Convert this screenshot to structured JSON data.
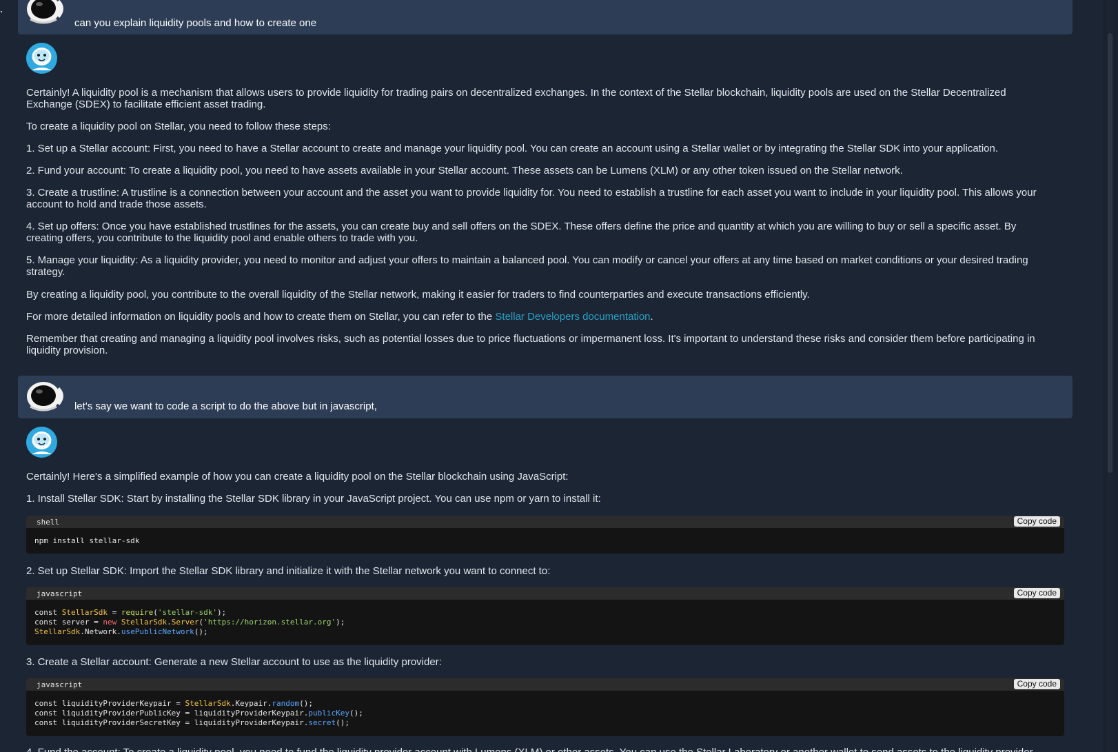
{
  "conversation": {
    "messages": [
      {
        "role": "user",
        "text": "can you explain liquidity pools and how to create one"
      },
      {
        "role": "assistant",
        "paragraphs": [
          "Certainly! A liquidity pool is a mechanism that allows users to provide liquidity for trading pairs on decentralized exchanges. In the context of the Stellar blockchain, liquidity pools are used on the Stellar Decentralized Exchange (SDEX) to facilitate efficient asset trading.",
          "To create a liquidity pool on Stellar, you need to follow these steps:",
          "1. Set up a Stellar account: First, you need to have a Stellar account to create and manage your liquidity pool. You can create an account using a Stellar wallet or by integrating the Stellar SDK into your application.",
          "2. Fund your account: To create a liquidity pool, you need to have assets available in your Stellar account. These assets can be Lumens (XLM) or any other token issued on the Stellar network.",
          "3. Create a trustline: A trustline is a connection between your account and the asset you want to provide liquidity for. You need to establish a trustline for each asset you want to include in your liquidity pool. This allows your account to hold and trade those assets.",
          "4. Set up offers: Once you have established trustlines for the assets, you can create buy and sell offers on the SDEX. These offers define the price and quantity at which you are willing to buy or sell a specific asset. By creating offers, you contribute to the liquidity pool and enable others to trade with you.",
          "5. Manage your liquidity: As a liquidity provider, you need to monitor and adjust your offers to maintain a balanced pool. You can modify or cancel your offers at any time based on market conditions or your desired trading strategy.",
          "By creating a liquidity pool, you contribute to the overall liquidity of the Stellar network, making it easier for traders to find counterparties and execute transactions efficiently.",
          "Remember that creating and managing a liquidity pool involves risks, such as potential losses due to price fluctuations or impermanent loss. It's important to understand these risks and consider them before participating in liquidity provision."
        ],
        "doc_line_prefix": "For more detailed information on liquidity pools and how to create them on Stellar, you can refer to the ",
        "doc_link": "Stellar Developers documentation",
        "doc_line_suffix": "."
      },
      {
        "role": "user",
        "text": "let's say we want to code a script to do the above but in javascript,"
      },
      {
        "role": "assistant",
        "intro": "Certainly! Here's a simplified example of how you can create a liquidity pool on the Stellar blockchain using JavaScript:",
        "step1": "1. Install Stellar SDK: Start by installing the Stellar SDK library in your JavaScript project. You can use npm or yarn to install it:",
        "step2": "2. Set up Stellar SDK: Import the Stellar SDK library and initialize it with the Stellar network you want to connect to:",
        "step3": "3. Create a Stellar account: Generate a new Stellar account to use as the liquidity provider:",
        "step4_partial": "4. Fund the account: To create a liquidity pool, you need to fund the liquidity provider account with Lumens (XLM) or other assets. You can use the Stellar Laboratory or another wallet to send assets to the liquidity provider"
      }
    ],
    "code_blocks": [
      {
        "lang": "shell",
        "copy_label": "Copy code",
        "code": "npm install stellar-sdk"
      },
      {
        "lang": "javascript",
        "copy_label": "Copy code",
        "lines": [
          [
            "const ",
            "StellarSdk",
            " = ",
            "require",
            "(",
            "'stellar-sdk'",
            ");"
          ],
          [
            "const server = ",
            "new ",
            "StellarSdk",
            ".",
            "Server",
            "(",
            "'https://horizon.stellar.org'",
            ");"
          ],
          [
            "StellarSdk",
            ".Network.",
            "usePublicNetwork",
            "();"
          ]
        ]
      },
      {
        "lang": "javascript",
        "copy_label": "Copy code",
        "lines": [
          [
            "const liquidityProviderKeypair = ",
            "StellarSdk",
            ".Keypair.",
            "random",
            "();"
          ],
          [
            "const liquidityProviderPublicKey = liquidityProviderKeypair.",
            "publicKey",
            "();"
          ],
          [
            "const liquidityProviderSecretKey = liquidityProviderKeypair.",
            "secret",
            "();"
          ]
        ]
      }
    ]
  },
  "icons": {
    "user_avatar": "astronaut-helmet-icon",
    "assistant_avatar": "robot-face-icon"
  },
  "colors": {
    "background": "#1b2534",
    "user_bubble": "#2d3d55",
    "link": "#2aa0c6",
    "code_bg": "#141414",
    "code_header": "#2c2c2c"
  }
}
